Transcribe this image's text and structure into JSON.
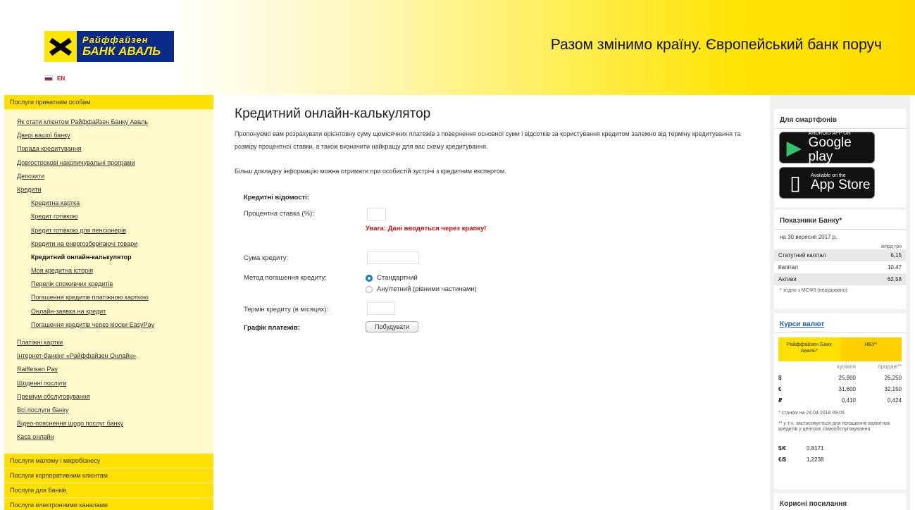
{
  "header": {
    "logo_line1": "Райффайзен",
    "logo_line2": "БАНК АВАЛЬ",
    "lang_en": "EN",
    "slogan": "Разом змінимо країну. Європейський банк поруч"
  },
  "left": {
    "top_category": "Послуги приватним особам",
    "items": [
      {
        "label": "Як стати клієнтом Райффайзен Банку Аваль",
        "style": "link"
      },
      {
        "label": "Двері вашої банку",
        "style": "link"
      },
      {
        "label": "Порада кредитування",
        "style": "link"
      },
      {
        "label": "Довгострокові накопичувальні програми",
        "style": "link"
      },
      {
        "label": "Депозити",
        "style": "link"
      },
      {
        "label": "Кредити",
        "style": "link"
      },
      {
        "label": "Кредитна картка",
        "style": "sub"
      },
      {
        "label": "Кредит готівкою",
        "style": "sub"
      },
      {
        "label": "Кредит готівкою для пенсіонерів",
        "style": "sub"
      },
      {
        "label": "Кредити на енергозберігаючі товари",
        "style": "sub"
      },
      {
        "label": "Кредитний онлайн-калькулятор",
        "style": "sub-bold"
      },
      {
        "label": "Моя кредитна історія",
        "style": "sub"
      },
      {
        "label": "Перелік споживчих кредитів",
        "style": "sub"
      },
      {
        "label": "Погашення кредитів платіжною карткою",
        "style": "sub"
      },
      {
        "label": "Онлайн-заявка на кредит",
        "style": "sub"
      },
      {
        "label": "Погашення кредитів через кіоски EasyPay",
        "style": "sub"
      },
      {
        "label": "Платіжні картки",
        "style": "gap"
      },
      {
        "label": "Інтернет-банкінг «Райффайзен Онлайн»",
        "style": "link"
      },
      {
        "label": "Raiffeisen Pay",
        "style": "link"
      },
      {
        "label": "Щоденні послуги",
        "style": "link"
      },
      {
        "label": "Преміум обслуговування",
        "style": "link"
      },
      {
        "label": "Всі послуги банку",
        "style": "link"
      },
      {
        "label": "Відео-пояснення щодо послуг банку",
        "style": "link"
      },
      {
        "label": "Каса онлайн",
        "style": "link"
      }
    ],
    "bottom_categories": [
      "Послуги малому і мікробізнесу",
      "Послуги корпоративним клієнтам",
      "Послуги для банків",
      "Послуги електронними каналами"
    ]
  },
  "main": {
    "title": "Кредитний онлайн-калькулятор",
    "para1": "Пропонуємо вам розрахувати орієнтовну суму щомісячних платежів з повернення основної суми і відсотків за користування кредитом залежно від терміну кредитування та розміру процентної ставки, а також визначити найкращу для вас схему кредитування.",
    "para2": "Більш докладну інформацію можна отримати при особистій зустрічі з кредитним експертом.",
    "section_label": "Кредитні відомості:",
    "rate_label": "Процентна ставка (%):",
    "rate_value": "",
    "warning": "Увага: Дані вводяться через крапку!",
    "amount_label": "Сума кредиту:",
    "amount_value": "",
    "method_label": "Метод погашення кредиту:",
    "method_options": [
      "Стандартний",
      "Ануїтетний (рівними частинами)"
    ],
    "method_selected": "Стандартний",
    "term_label": "Термін кредиту (в місяцях):",
    "term_value": "",
    "schedule_label": "Графік платежів:",
    "build_button": "Побудувати"
  },
  "right": {
    "smartphones_head": "Для смартфонів",
    "google_small": "ANDROID APP ON",
    "google_big": "Google play",
    "apple_small": "Available on the",
    "apple_big": "App Store",
    "indicators_head": "Показники Банку*",
    "indicators_date": "на 30 вересня 2017 р.",
    "indicators_unit": "млрд грн",
    "indicators": [
      {
        "name": "Статутний капітал",
        "value": "6,15"
      },
      {
        "name": "Капітал",
        "value": "10,47"
      },
      {
        "name": "Активи",
        "value": "62,58"
      }
    ],
    "indicators_note": "* згідно з МСФЗ (неаудовано)",
    "rates_head": "Курси валют",
    "rates_col1": "Райффайзен Банк Аваль*",
    "rates_col2": "НБУ*",
    "rates_sub1": "купівля",
    "rates_sub2": "продаж**",
    "rates": [
      {
        "cur": "$",
        "buy": "25,900",
        "sell": "26,250"
      },
      {
        "cur": "€",
        "buy": "31,600",
        "sell": "32,150"
      },
      {
        "cur": "₽",
        "buy": "0,410",
        "sell": "0,424"
      }
    ],
    "rates_note1": "* станом на 24.04.2018 09:05",
    "rates_note2": "** у т.ч. застосовується для погашення валютних кредитів у центрах самообслуговування",
    "cross": [
      {
        "pair": "$/€",
        "value": "0,8171"
      },
      {
        "pair": "€/$",
        "value": "1,2238"
      }
    ],
    "useful_head": "Корисні посилання"
  }
}
